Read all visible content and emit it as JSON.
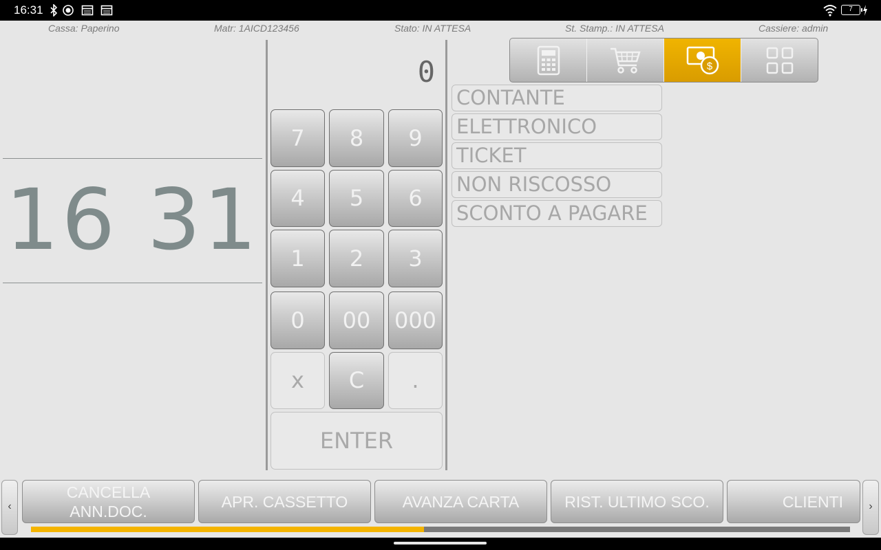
{
  "statusbar": {
    "time": "16:31",
    "battery": "7"
  },
  "infobar": {
    "cassa": "Cassa: Paperino",
    "matricola": "Matr: 1AICD123456",
    "stato": "Stato: IN ATTESA",
    "stampante": "St. Stamp.: IN ATTESA",
    "cassiere": "Cassiere: admin"
  },
  "clock": "16 31",
  "display": {
    "value": "0"
  },
  "keypad": {
    "k7": "7",
    "k8": "8",
    "k9": "9",
    "k4": "4",
    "k5": "5",
    "k6": "6",
    "k1": "1",
    "k2": "2",
    "k3": "3",
    "k0": "0",
    "k00": "00",
    "k000": "000",
    "kx": "x",
    "kc": "C",
    "kdot": ".",
    "enter": "ENTER"
  },
  "tabs": [
    {
      "icon": "calculator-icon"
    },
    {
      "icon": "cart-icon"
    },
    {
      "icon": "money-icon",
      "active": true
    },
    {
      "icon": "grid-icon"
    }
  ],
  "payments": [
    "CONTANTE",
    "ELETTRONICO",
    "TICKET",
    "NON RISCOSSO",
    "SCONTO A PAGARE"
  ],
  "functions": {
    "cancella_line1": "CANCELLA",
    "cancella_line2": "ANN.DOC.",
    "cassetto": "APR. CASSETTO",
    "carta": "AVANZA CARTA",
    "ultimo_sco": "RIST. ULTIMO SCO.",
    "clienti": "CLIENTI"
  },
  "nav": {
    "prev": "‹",
    "next": "›"
  },
  "scroll_progress": 0.48,
  "colors": {
    "accent": "#f4b400",
    "background": "#e6e6e6"
  }
}
